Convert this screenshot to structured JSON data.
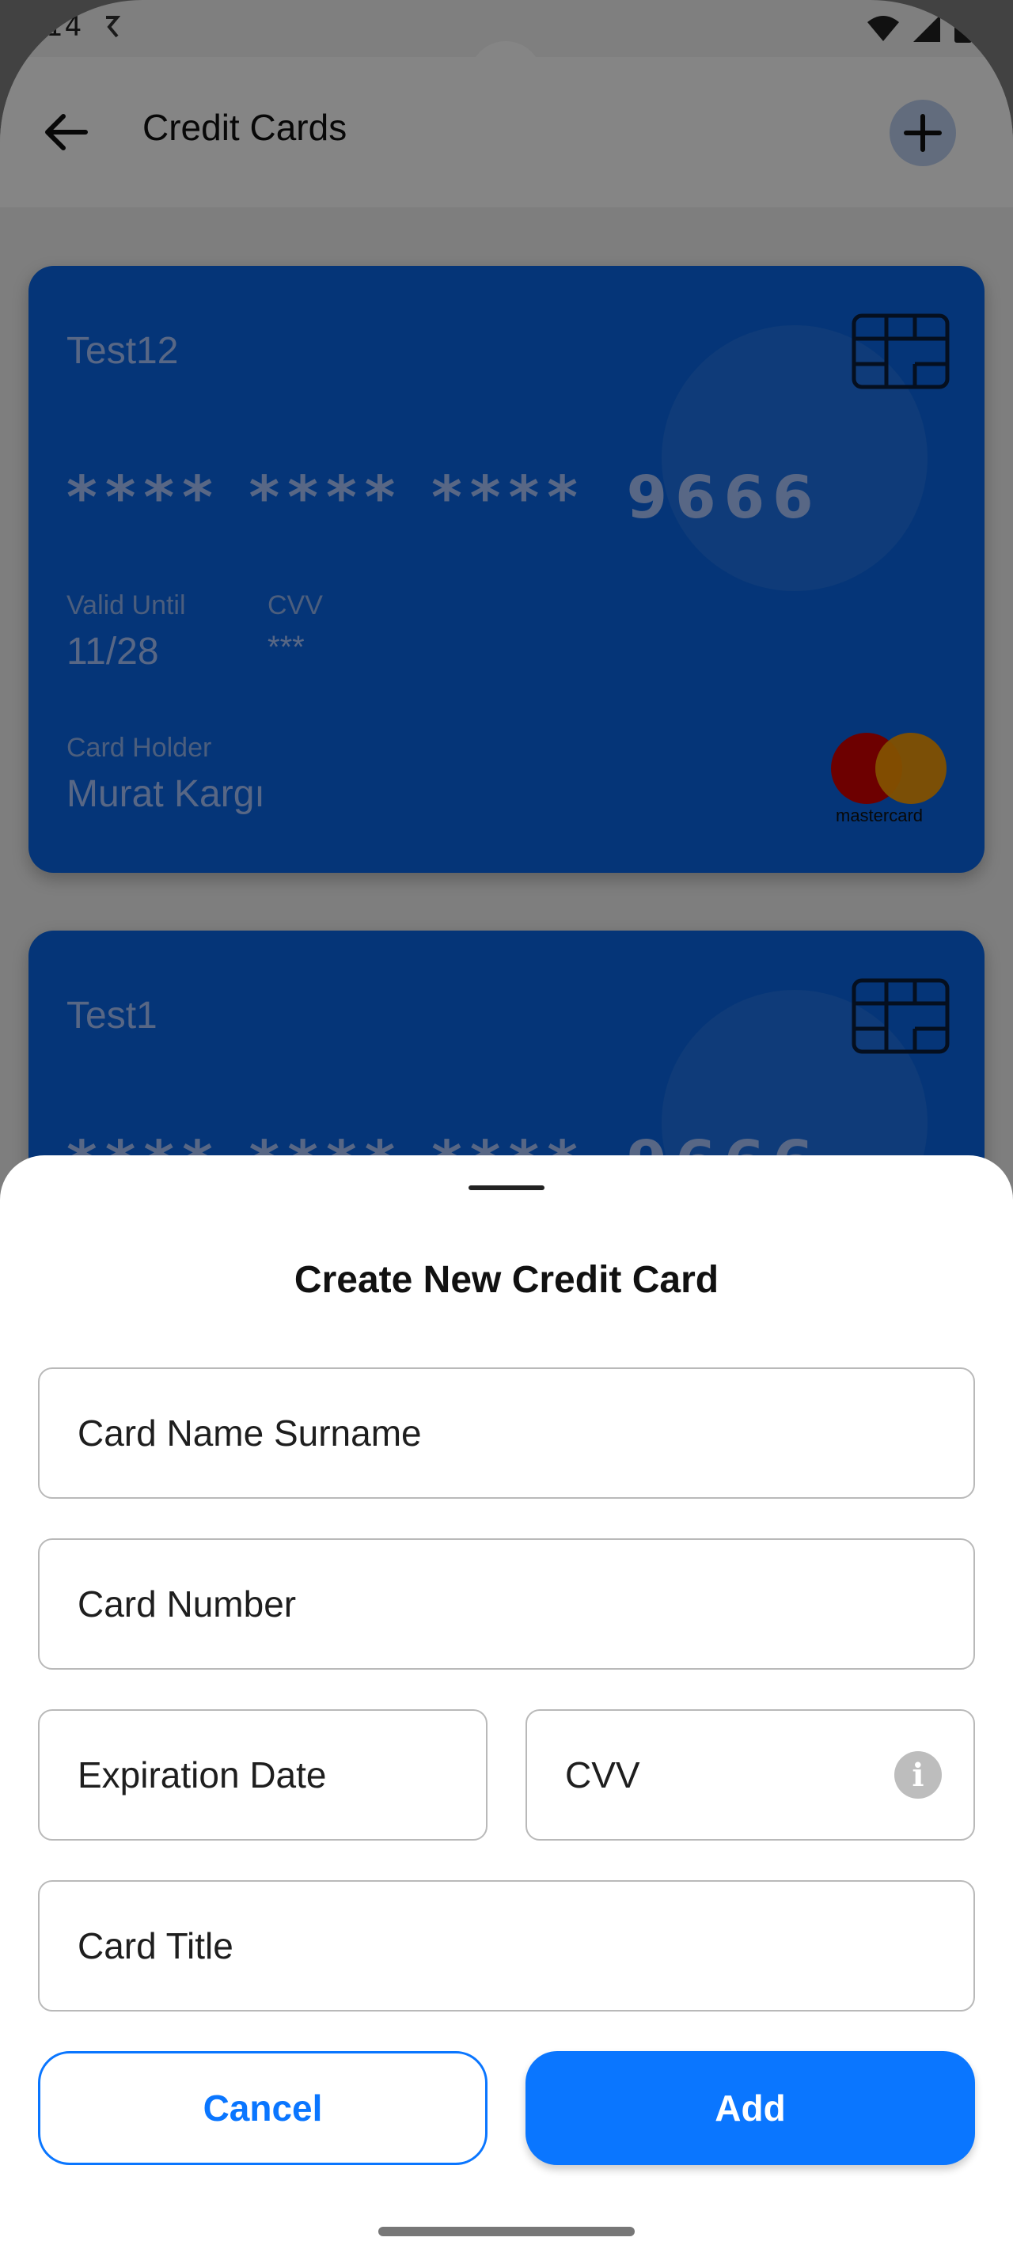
{
  "status_bar": {
    "time": "14"
  },
  "app_bar": {
    "title": "Credit Cards"
  },
  "cards": [
    {
      "title": "Test12",
      "number_masked": "**** **** ****",
      "number_last4": "9666",
      "valid_until_label": "Valid Until",
      "valid_until": "11/28",
      "cvv_label": "CVV",
      "cvv": "***",
      "holder_label": "Card Holder",
      "holder": "Murat Kargı",
      "brand": "mastercard"
    },
    {
      "title": "Test1",
      "number_masked": "**** **** ****",
      "number_last4": "9666"
    }
  ],
  "sheet": {
    "title": "Create New Credit Card",
    "fields": {
      "name": "Card Name Surname",
      "number": "Card Number",
      "expiry": "Expiration Date",
      "cvv": "CVV",
      "title": "Card Title"
    },
    "cancel_label": "Cancel",
    "add_label": "Add"
  },
  "colors": {
    "card": "#0a67e6",
    "accent": "#0a76ff"
  }
}
